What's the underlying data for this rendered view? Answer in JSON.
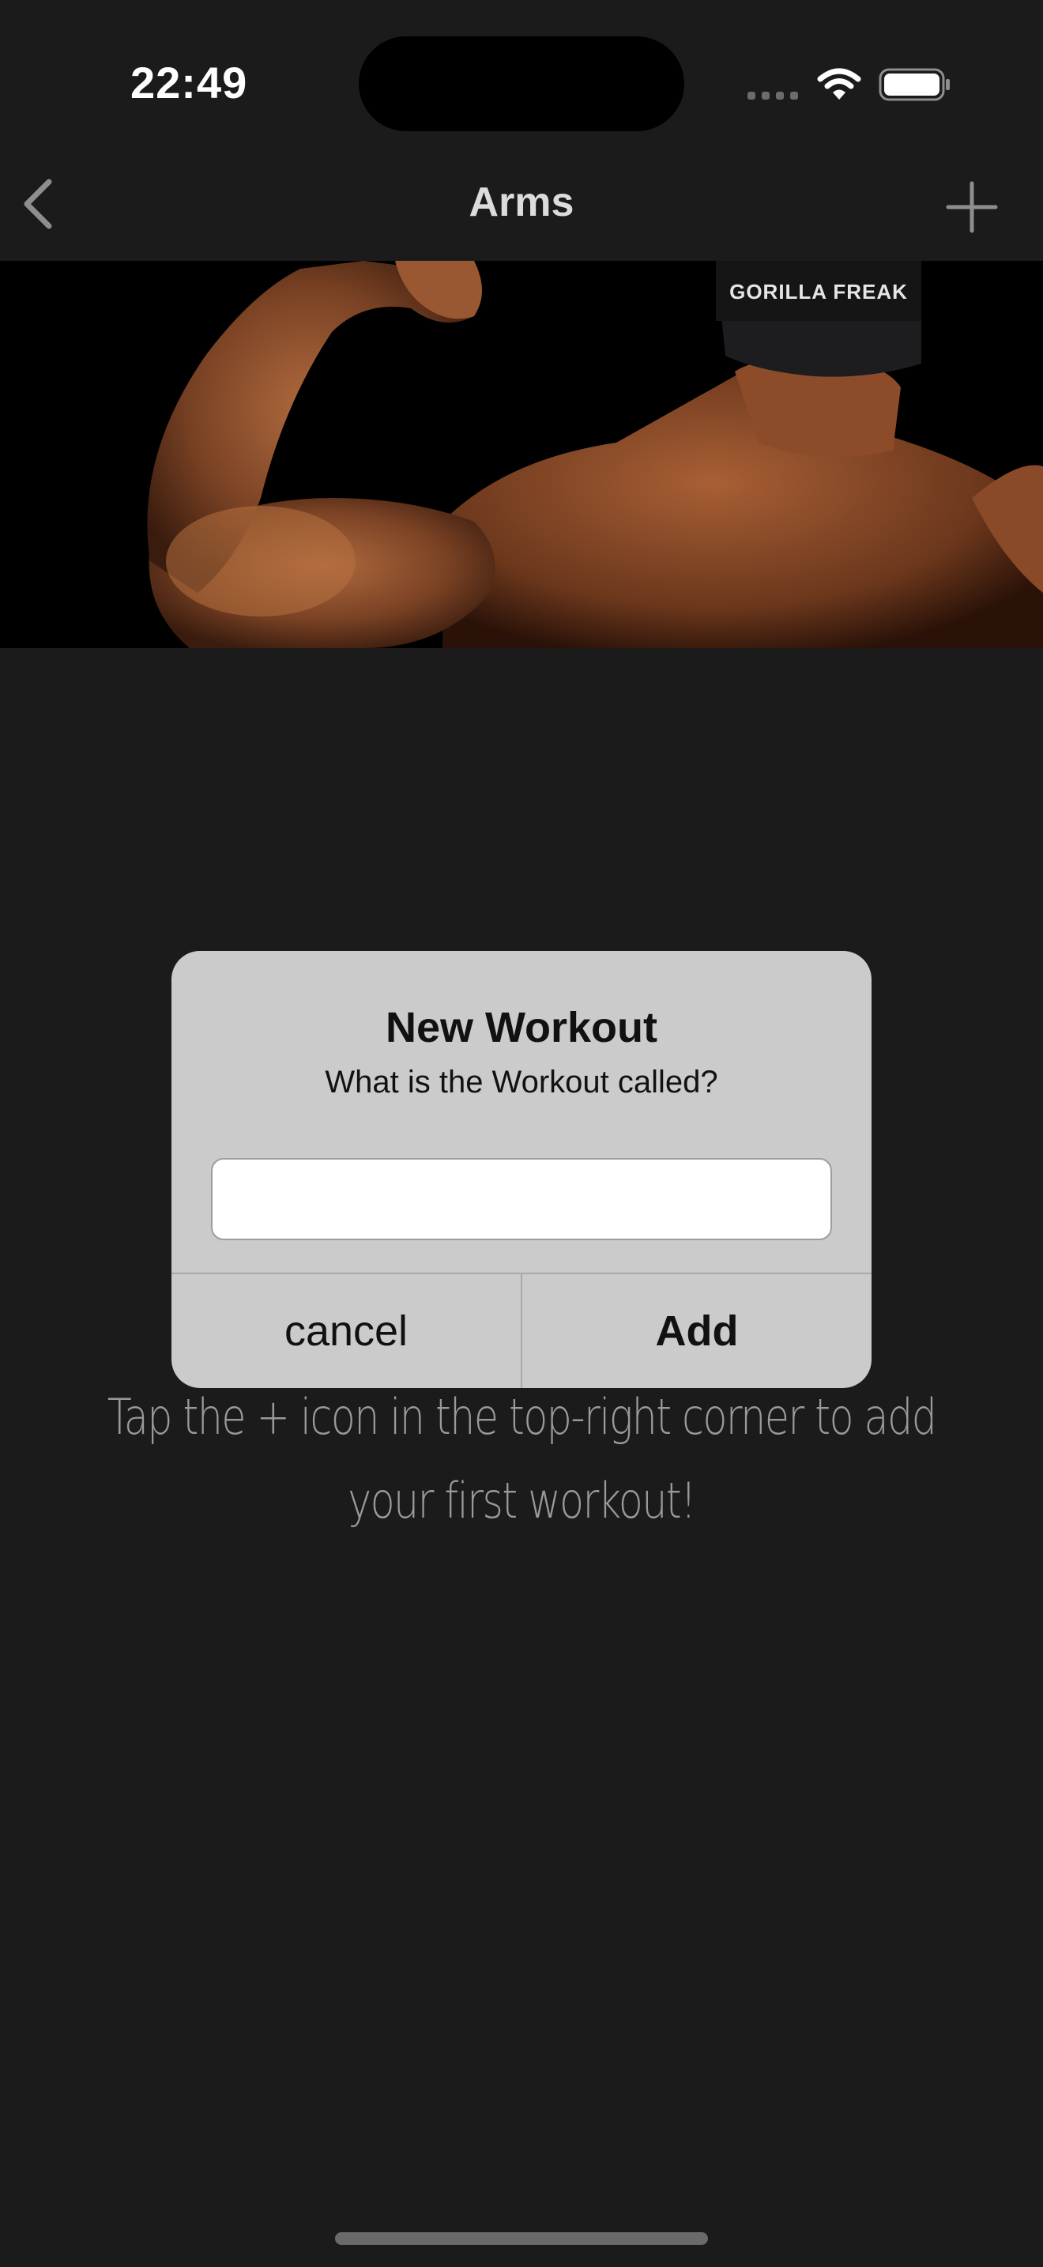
{
  "status_bar": {
    "time": "22:49",
    "icons": [
      "cellular-dots-icon",
      "wifi-icon",
      "battery-icon"
    ]
  },
  "nav": {
    "title": "Arms",
    "back_icon": "chevron-left-icon",
    "add_icon": "plus-icon"
  },
  "hero": {
    "image": "flexing-bodybuilder-back-photo",
    "cap_text": "GORILLA FREAK"
  },
  "empty_state": {
    "message": "Tap the + icon in the top-right corner to add your first workout!"
  },
  "alert": {
    "title": "New Workout",
    "message": "What is the Workout called?",
    "input_value": "",
    "input_placeholder": "",
    "cancel_label": "cancel",
    "add_label": "Add"
  },
  "colors": {
    "background": "#1b1b1c",
    "alert_background": "#cbcbcb",
    "nav_text": "#dcdcdc",
    "hint_text": "#9a9a9c"
  }
}
